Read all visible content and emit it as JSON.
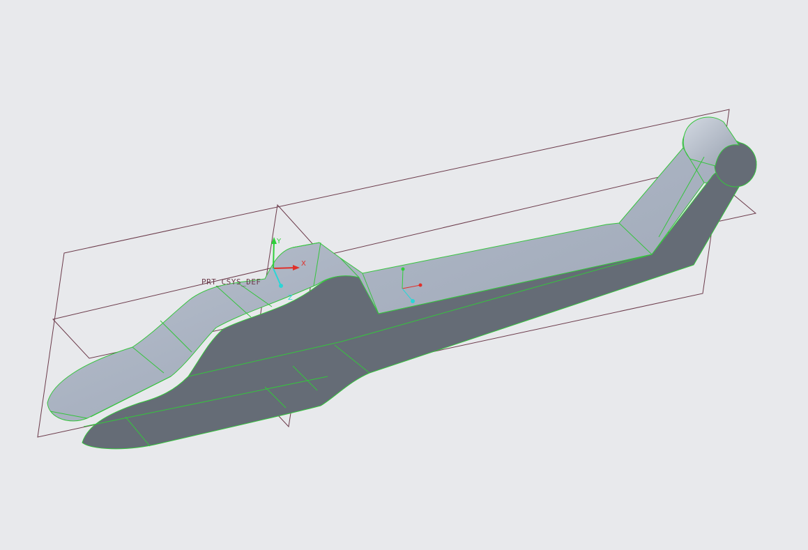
{
  "viewport": {
    "background": "#e8e9ec"
  },
  "csys": {
    "name": "PRT_CSYS_DEF",
    "x_label": "X",
    "y_label": "Y",
    "z_label": "Z",
    "x_color": "#e0302a",
    "y_color": "#2fcf3a",
    "z_color": "#2ad6d6"
  },
  "model": {
    "top_face_color": "#a8b1c0",
    "side_face_color": "#656c76",
    "edge_color": "#35c43d",
    "datum_plane_color": "#6b3a4a"
  }
}
